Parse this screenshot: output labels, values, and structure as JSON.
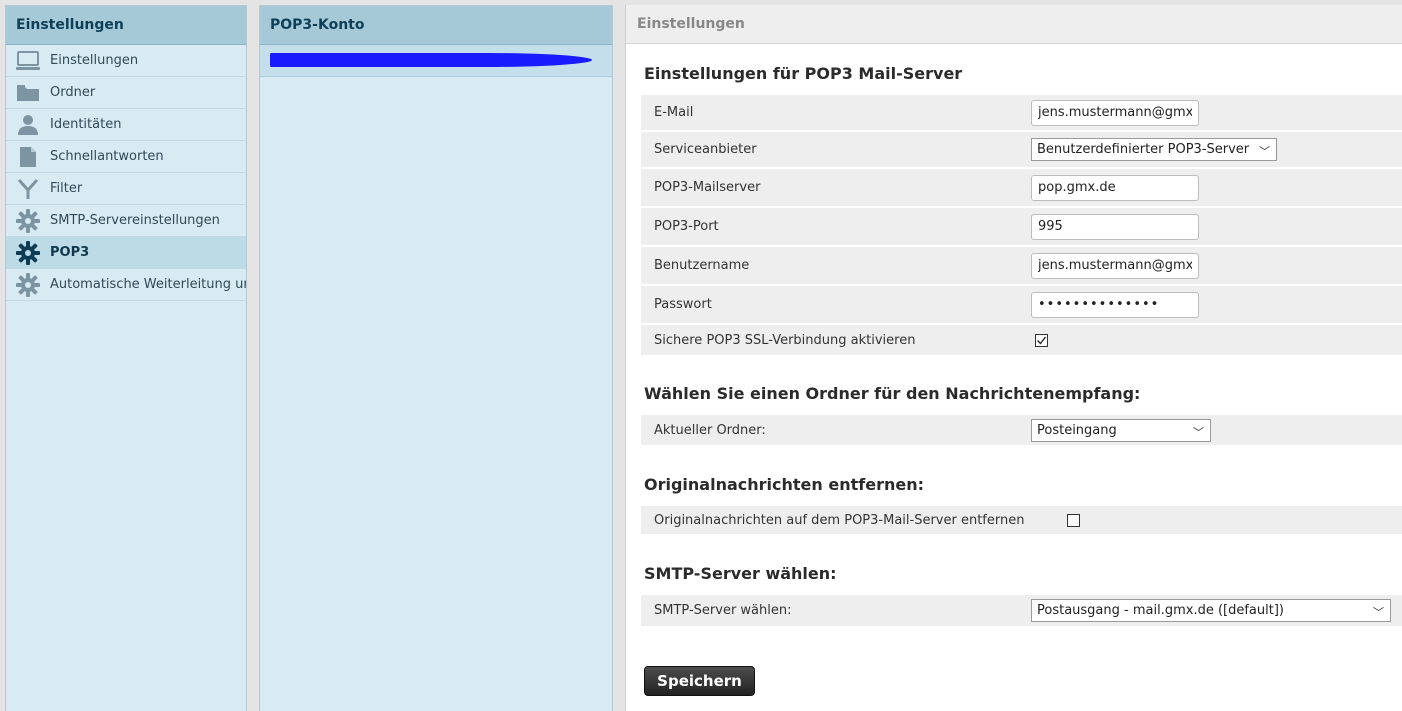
{
  "left_panel": {
    "title": "Einstellungen",
    "items": [
      {
        "label": "Einstellungen",
        "icon": "monitor-icon"
      },
      {
        "label": "Ordner",
        "icon": "folder-icon"
      },
      {
        "label": "Identitäten",
        "icon": "person-icon"
      },
      {
        "label": "Schnellantworten",
        "icon": "document-icon"
      },
      {
        "label": "Filter",
        "icon": "filter-icon"
      },
      {
        "label": "SMTP-Servereinstellungen",
        "icon": "gear-icon"
      },
      {
        "label": "POP3",
        "icon": "gear-icon",
        "active": true
      },
      {
        "label": "Automatische Weiterleitung und Abwesenheitsnotiz",
        "icon": "gear-icon"
      }
    ]
  },
  "middle_panel": {
    "title": "POP3-Konto",
    "account_redacted_color": "#1a1aff"
  },
  "content": {
    "header": "Einstellungen",
    "server_section": {
      "title": "Einstellungen für POP3 Mail-Server",
      "email_label": "E-Mail",
      "email_value": "jens.mustermann@gmx.de",
      "provider_label": "Serviceanbieter",
      "provider_value": "Benutzerdefinierter POP3-Server",
      "server_label": "POP3-Mailserver",
      "server_value": "pop.gmx.de",
      "port_label": "POP3-Port",
      "port_value": "995",
      "username_label": "Benutzername",
      "username_value": "jens.mustermann@gmx.de",
      "password_label": "Passwort",
      "password_value": "••••••••••••••",
      "ssl_label": "Sichere POP3 SSL-Verbindung aktivieren",
      "ssl_checked": true
    },
    "folder_section": {
      "title": "Wählen Sie einen Ordner für den Nachrichtenempfang:",
      "folder_label": "Aktueller Ordner:",
      "folder_value": "Posteingang"
    },
    "remove_section": {
      "title": "Originalnachrichten entfernen:",
      "remove_label": "Originalnachrichten auf dem POP3-Mail-Server entfernen",
      "remove_checked": false
    },
    "smtp_section": {
      "title": "SMTP-Server wählen:",
      "smtp_label": "SMTP-Server wählen:",
      "smtp_value": "Postausgang - mail.gmx.de ([default])"
    },
    "save_label": "Speichern"
  },
  "colors": {
    "sidebar_bg": "#d8eaf2",
    "header_bg": "#a6c9d7",
    "header_text": "#0d3f57",
    "active_item_bg": "#bcdbe7",
    "icon_color": "#7d95a3",
    "active_icon_color": "#0f3c55"
  }
}
